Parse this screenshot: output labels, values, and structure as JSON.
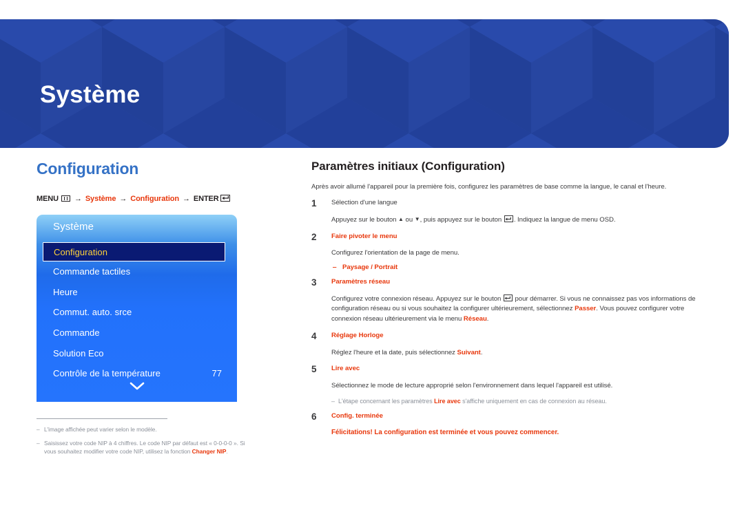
{
  "banner": {
    "title": "Système",
    "bg_color": "#22409a"
  },
  "left": {
    "section_title": "Configuration",
    "menu_path": {
      "menu_label": "MENU",
      "menu_icon": "menu-grid-icon",
      "arrow": "→",
      "item1": "Système",
      "item2": "Configuration",
      "enter_label": "ENTER",
      "enter_icon": "enter-return-icon"
    },
    "osd": {
      "title": "Système",
      "items": [
        {
          "label": "Configuration",
          "value": "",
          "selected": true
        },
        {
          "label": "Commande tactiles",
          "value": "",
          "selected": false
        },
        {
          "label": "Heure",
          "value": "",
          "selected": false
        },
        {
          "label": "Commut. auto. srce",
          "value": "",
          "selected": false
        },
        {
          "label": "Commande",
          "value": "",
          "selected": false
        },
        {
          "label": "Solution Eco",
          "value": "",
          "selected": false
        },
        {
          "label": "Contrôle de la température",
          "value": "77",
          "selected": false
        }
      ],
      "more_icon": "chevron-down-icon",
      "selected_bg": "#0a1a73",
      "selected_text": "#ffd23a"
    },
    "footnotes": [
      {
        "dash": "‒",
        "parts": [
          {
            "text": "L'image affichée peut varier selon le modèle.",
            "bold": false
          }
        ]
      },
      {
        "dash": "‒",
        "parts": [
          {
            "text": "Saisissez votre code NIP à 4 chiffres. Le code NIP par défaut est « 0-0-0-0 ». Si vous souhaitez modifier votre code NIP, utilisez la fonction ",
            "bold": false
          },
          {
            "text": "Changer NIP",
            "bold": true
          },
          {
            "text": ".",
            "bold": false
          }
        ]
      }
    ]
  },
  "right": {
    "heading": "Paramètres initiaux (Configuration)",
    "intro": "Après avoir allumé l'appareil pour la première fois, configurez les paramètres de base comme la langue, le canal et l'heure.",
    "steps": [
      {
        "num": "1",
        "title": "Sélection d'une langue",
        "title_accent": false,
        "body_parts": [
          {
            "text": "Appuyez sur le bouton ",
            "bold": false
          },
          {
            "text": "▲",
            "bold": false
          },
          {
            "text": " ou ",
            "bold": false
          },
          {
            "text": "▼",
            "bold": false
          },
          {
            "text": ", puis appuyez sur le bouton ",
            "bold": false
          },
          {
            "text": "[ENTER]",
            "bold": false,
            "icon": true
          },
          {
            "text": ". Indiquez la langue de menu OSD.",
            "bold": false
          }
        ]
      },
      {
        "num": "2",
        "title": "Faire pivoter le menu",
        "title_accent": true,
        "body_parts": [
          {
            "text": "Configurez l'orientation de la page de menu.",
            "bold": false
          }
        ],
        "bullet": {
          "dash": "‒",
          "text": "Paysage / Portrait"
        }
      },
      {
        "num": "3",
        "title": "Paramètres réseau",
        "title_accent": true,
        "body_parts": [
          {
            "text": "Configurez votre connexion réseau. Appuyez sur le bouton ",
            "bold": false
          },
          {
            "text": "[ENTER]",
            "bold": false,
            "icon": true
          },
          {
            "text": " pour démarrer. Si vous ne connaissez pas vos informations de configuration réseau ou si vous souhaitez la configurer ultérieurement, sélectionnez ",
            "bold": false
          },
          {
            "text": "Passer",
            "bold": true
          },
          {
            "text": ". Vous pouvez configurer votre connexion réseau ultérieurement via le menu ",
            "bold": false
          },
          {
            "text": "Réseau",
            "bold": true
          },
          {
            "text": ".",
            "bold": false
          }
        ]
      },
      {
        "num": "4",
        "title": "Réglage Horloge",
        "title_accent": true,
        "body_parts": [
          {
            "text": "Réglez l'heure et la date, puis sélectionnez ",
            "bold": false
          },
          {
            "text": "Suivant",
            "bold": true
          },
          {
            "text": ".",
            "bold": false
          }
        ]
      },
      {
        "num": "5",
        "title": "Lire avec",
        "title_accent": true,
        "body_parts": [
          {
            "text": "Sélectionnez le mode de lecture approprié selon l'environnement dans lequel l'appareil est utilisé.",
            "bold": false
          }
        ],
        "note": {
          "dash": "‒",
          "parts": [
            {
              "text": "L'étape concernant les paramètres ",
              "bold": false
            },
            {
              "text": "Lire avec",
              "bold": true
            },
            {
              "text": " s'affiche uniquement en cas de connexion au réseau.",
              "bold": false
            }
          ]
        }
      },
      {
        "num": "6",
        "title": "Config. terminée",
        "title_accent": true,
        "congrats": "Félicitations! La configuration est terminée et vous pouvez commencer."
      }
    ]
  },
  "colors": {
    "accent_red": "#e8380d",
    "heading_blue": "#3572c6",
    "banner_blue": "#22409a"
  }
}
